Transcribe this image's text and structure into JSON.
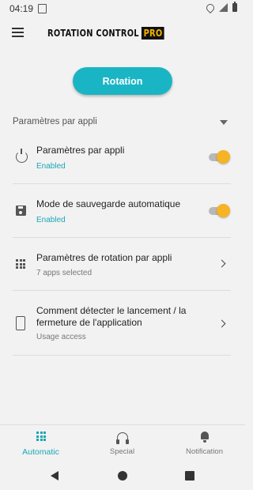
{
  "status_bar": {
    "time": "04:19"
  },
  "app_bar": {
    "logo_text": "ROTATION CONTROL",
    "logo_badge": "PRO"
  },
  "main": {
    "rotation_button": "Rotation",
    "section_title": "Paramètres par appli",
    "items": [
      {
        "title": "Paramètres par appli",
        "subtitle": "Enabled",
        "control": "toggle",
        "toggle_on": true,
        "icon": "power-icon"
      },
      {
        "title": "Mode de sauvegarde automatique",
        "subtitle": "Enabled",
        "control": "toggle",
        "toggle_on": true,
        "icon": "save-icon"
      },
      {
        "title": "Paramètres de rotation par appli",
        "subtitle": "7 apps selected",
        "control": "chevron",
        "icon": "apps-grid-icon"
      },
      {
        "title": "Comment détecter le lancement / la fermeture de l'application",
        "subtitle": "Usage access",
        "control": "chevron",
        "icon": "phone-icon"
      }
    ]
  },
  "bottom_nav": {
    "tabs": [
      {
        "label": "Automatic",
        "active": true,
        "icon": "grid-dots-icon"
      },
      {
        "label": "Special",
        "active": false,
        "icon": "headphones-icon"
      },
      {
        "label": "Notification",
        "active": false,
        "icon": "bell-icon"
      }
    ]
  },
  "colors": {
    "accent": "#1ab5c4",
    "toggle_thumb": "#f6b323",
    "logo_badge": "#f5b400"
  }
}
